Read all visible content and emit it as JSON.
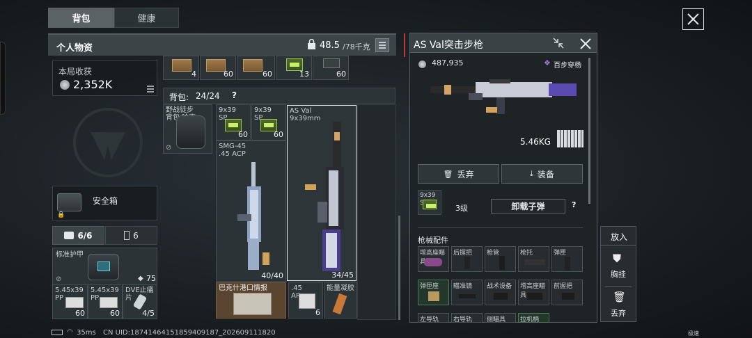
{
  "tabs": [
    {
      "label": "背包"
    },
    {
      "label": "健康"
    }
  ],
  "personal": {
    "title": "个人物资",
    "weight": "48.5",
    "weight_max": "/78千克",
    "earnings_label": "本局收获",
    "earnings_value": "2,352K",
    "safebox_label": "安全箱"
  },
  "counts": {
    "armor": "6/6",
    "items": "6"
  },
  "armor": {
    "name": "标准护甲",
    "durability": "75"
  },
  "bottom_items": [
    {
      "label": "5.45x39 PP",
      "qty": "60"
    },
    {
      "label": "5.45x39 PP",
      "qty": "60"
    },
    {
      "label": "DVE止痛片",
      "qty": "4/5"
    }
  ],
  "top_strip_qty": [
    "4",
    "60",
    "60",
    "13",
    "60"
  ],
  "backpack": {
    "title": "背包:",
    "capacity": "24/24",
    "help": "?",
    "pack_name": "野战徒步背包 哈克",
    "ammo1": {
      "label": "9x39 SP",
      "qty": "60"
    },
    "ammo2": {
      "label": "9x39 SP",
      "qty": "60"
    },
    "smg": {
      "label": "SMG-45 .45 ACP",
      "ammo": "40/40"
    },
    "asval": {
      "label": "AS Val 9x39mm",
      "ammo": "34/45"
    },
    "map_label": "巴克什港口情报",
    "acp": {
      "label": ".45 AP",
      "qty": "6"
    },
    "gel": {
      "label": "能量凝胶"
    }
  },
  "detail": {
    "title": "AS Val突击步枪",
    "price": "487,935",
    "tag": "百步穿杨",
    "weight": "5.46KG",
    "discard_label": "丢弃",
    "equip_label": "装备",
    "ammo_label": "9x39 SP",
    "level": "3级",
    "unload_label": "卸载子弹",
    "help": "?",
    "attachments_title": "枪械配件",
    "attachments": [
      "增高座瞄具",
      "后握把",
      "枪管",
      "枪托",
      "弹匣",
      "弹匣座",
      "瞄准镜",
      "战术设备",
      "增高座瞄具",
      "前握把",
      "左导轨",
      "右导轨",
      "侧瞄具",
      "拉机柄"
    ]
  },
  "side_actions": {
    "title": "放入",
    "chest": "胸挂",
    "discard": "丢弃"
  },
  "status": {
    "ping": "35ms",
    "uid": "CN UID:18741464151859409187_202609111820",
    "speed": "极速"
  },
  "colors": {
    "accent_red": "#c0393b",
    "ammo_green": "#9dc94a",
    "tag_purple": "#a67be0"
  }
}
